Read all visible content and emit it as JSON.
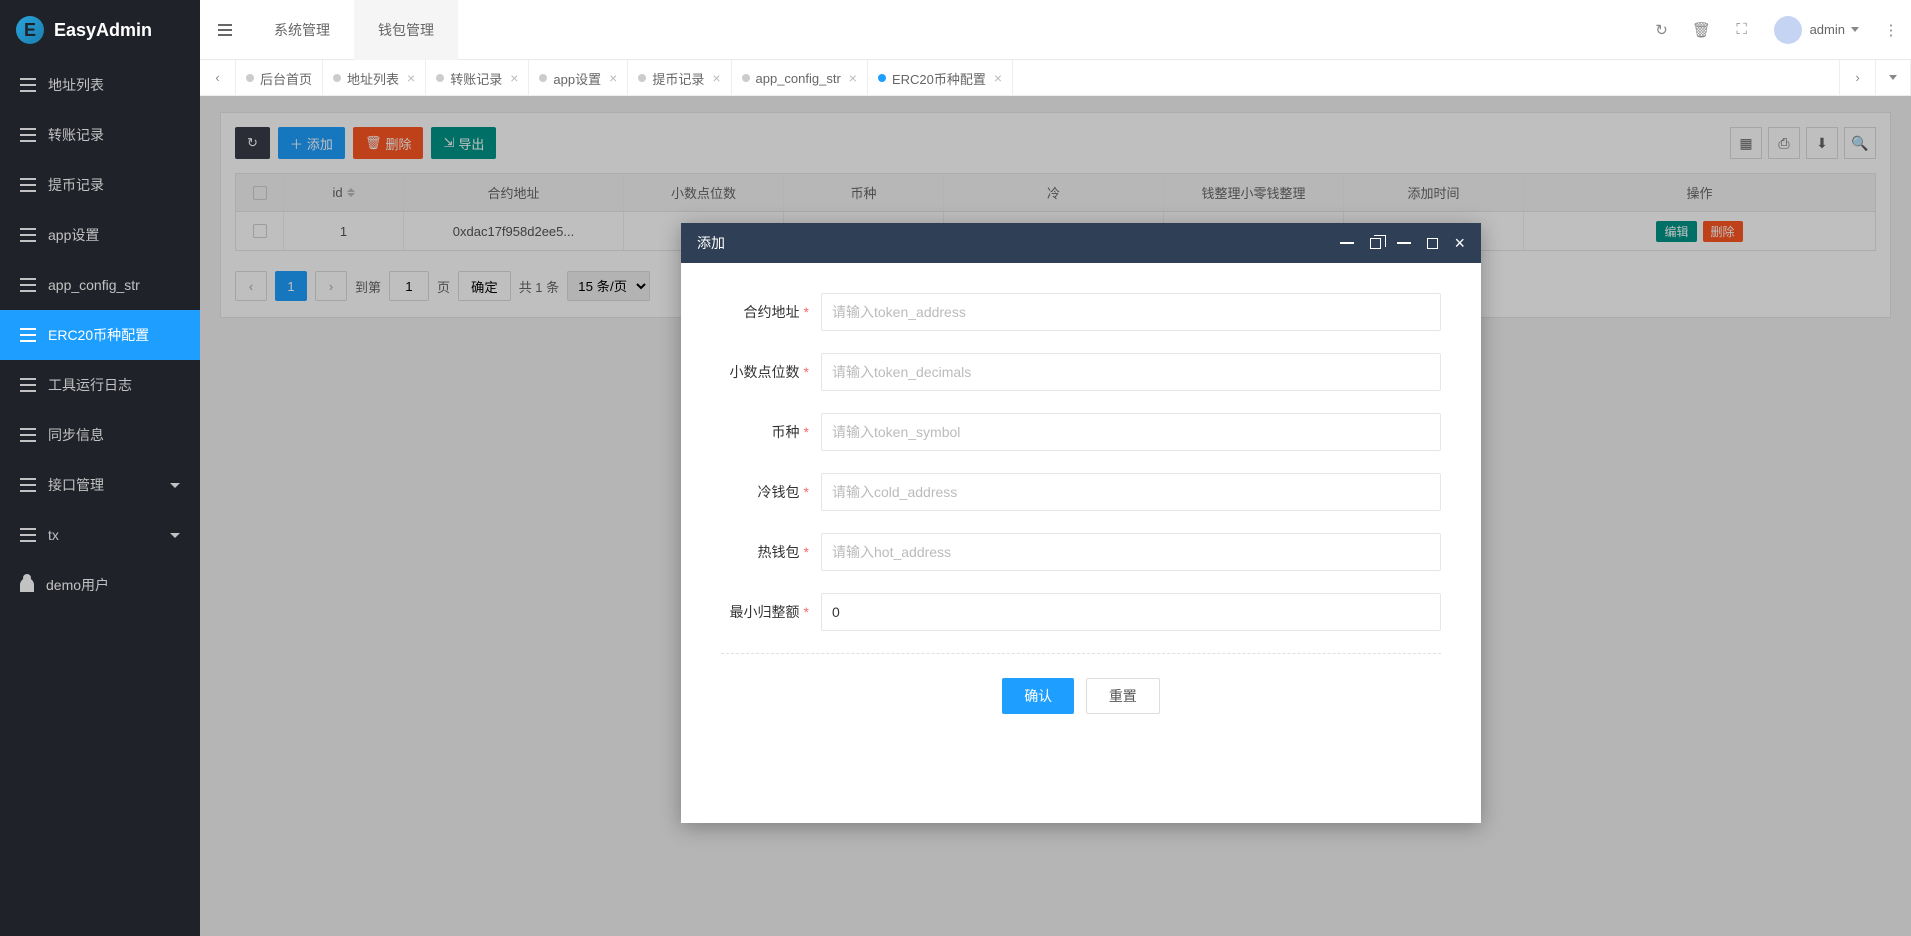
{
  "brand": "EasyAdmin",
  "sidebar": {
    "items": [
      {
        "label": "地址列表"
      },
      {
        "label": "转账记录"
      },
      {
        "label": "提币记录"
      },
      {
        "label": "app设置"
      },
      {
        "label": "app_config_str"
      },
      {
        "label": "ERC20币种配置"
      },
      {
        "label": "工具运行日志"
      },
      {
        "label": "同步信息"
      },
      {
        "label": "接口管理"
      },
      {
        "label": "tx"
      },
      {
        "label": "demo用户"
      }
    ]
  },
  "header": {
    "navs": [
      {
        "label": "系统管理"
      },
      {
        "label": "钱包管理"
      }
    ],
    "user": "admin"
  },
  "tabs": {
    "items": [
      {
        "label": "后台首页",
        "closable": false
      },
      {
        "label": "地址列表",
        "closable": true
      },
      {
        "label": "转账记录",
        "closable": true
      },
      {
        "label": "app设置",
        "closable": true
      },
      {
        "label": "提币记录",
        "closable": true
      },
      {
        "label": "app_config_str",
        "closable": true
      },
      {
        "label": "ERC20币种配置",
        "closable": true,
        "active": true
      }
    ]
  },
  "toolbar": {
    "add": "添加",
    "delete": "删除",
    "export": "导出"
  },
  "table": {
    "columns": [
      "id",
      "合约地址",
      "小数点位数",
      "币种",
      "冷",
      "钱整理小零钱整理",
      "添加时间",
      "操作"
    ],
    "rows": [
      {
        "id": "1",
        "addr": "0xdac17f958d2ee5...",
        "edit_label": "编辑",
        "del_label": "删除"
      }
    ]
  },
  "pager": {
    "goto_label": "到第",
    "page_unit": "页",
    "confirm": "确定",
    "total": "共 1 条",
    "page_input": "1",
    "per_page": "15 条/页"
  },
  "modal": {
    "title": "添加",
    "fields": [
      {
        "label": "合约地址",
        "placeholder": "请输入token_address",
        "value": ""
      },
      {
        "label": "小数点位数",
        "placeholder": "请输入token_decimals",
        "value": ""
      },
      {
        "label": "币种",
        "placeholder": "请输入token_symbol",
        "value": ""
      },
      {
        "label": "冷钱包",
        "placeholder": "请输入cold_address",
        "value": ""
      },
      {
        "label": "热钱包",
        "placeholder": "请输入hot_address",
        "value": ""
      },
      {
        "label": "最小归整额",
        "placeholder": "",
        "value": "0"
      }
    ],
    "confirm": "确认",
    "reset": "重置"
  }
}
